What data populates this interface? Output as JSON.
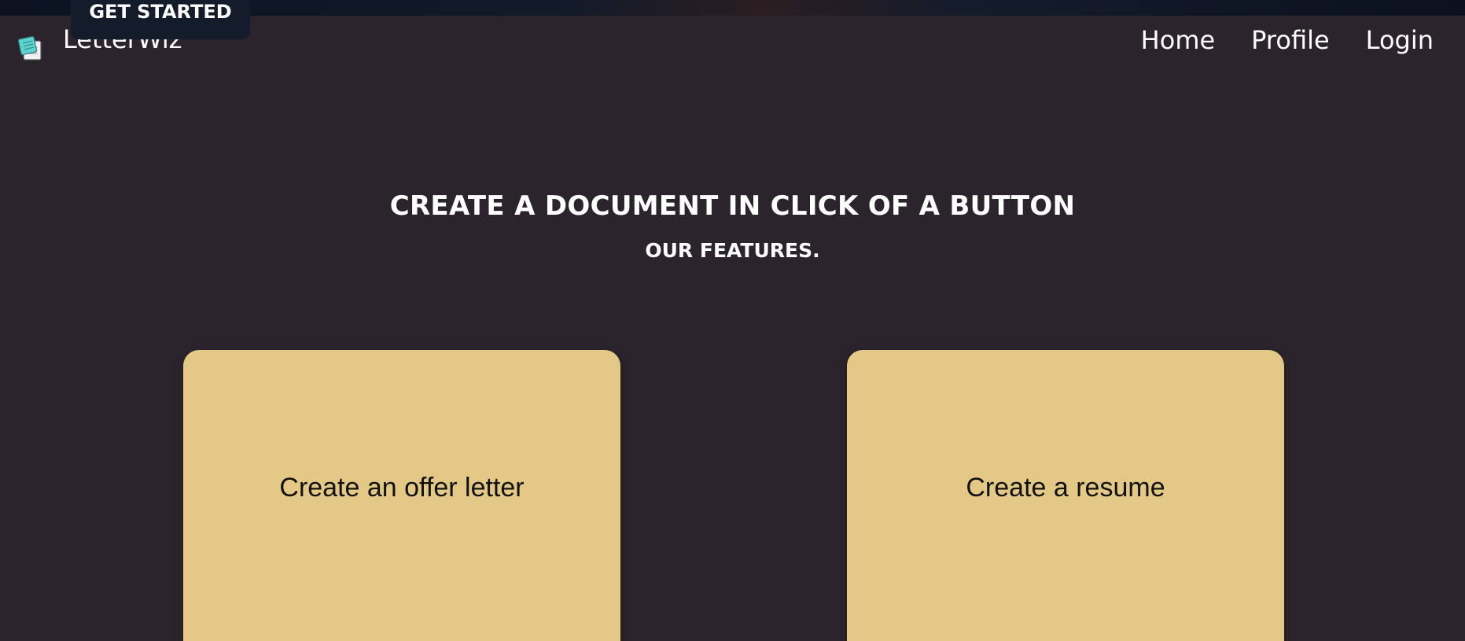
{
  "cta": {
    "get_started_label": "GET STARTED"
  },
  "nav": {
    "brand": "LetterWiz",
    "logo_icon": "notepad-icon",
    "links": [
      {
        "label": "Home"
      },
      {
        "label": "Profile"
      },
      {
        "label": "Login"
      }
    ]
  },
  "hero": {
    "title": "CREATE A DOCUMENT IN CLICK OF A BUTTON",
    "subtitle": "OUR FEATURES."
  },
  "features": [
    {
      "label": "Create an offer letter"
    },
    {
      "label": "Create a resume"
    }
  ],
  "colors": {
    "background": "#2b242c",
    "card": "#e3c985",
    "card_text": "#111111",
    "cta_background": "#141c2c",
    "logo_accent": "#5fd3d0"
  }
}
